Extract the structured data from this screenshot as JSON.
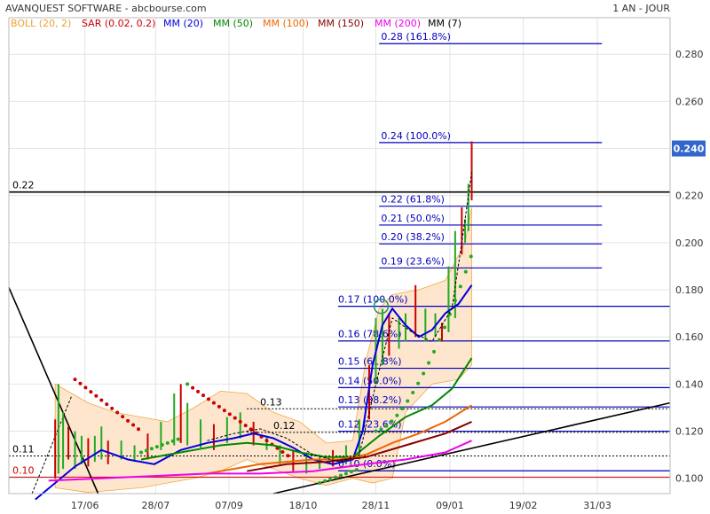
{
  "chart_data": {
    "type": "line",
    "title": "AVANQUEST SOFTWARE - abcbourse.com",
    "period": "1 AN - JOUR",
    "last_price": "0.240",
    "y_ticks": [
      "0.280",
      "0.260",
      "0.240",
      "0.220",
      "0.200",
      "0.180",
      "0.160",
      "0.140",
      "0.120",
      "0.100"
    ],
    "y_tick_values": [
      0.28,
      0.26,
      0.24,
      0.22,
      0.2,
      0.18,
      0.16,
      0.14,
      0.12,
      0.1
    ],
    "ylim": [
      0.0935,
      0.2955
    ],
    "x_ticks": [
      "17/06",
      "28/07",
      "07/09",
      "18/10",
      "28/11",
      "09/01",
      "19/02",
      "31/03"
    ],
    "grid": true,
    "legend": [
      {
        "label": "BOLL (20, 2)",
        "color": "#f0a030"
      },
      {
        "label": "SAR (0.02, 0.2)",
        "color": "#cc0000"
      },
      {
        "label": "MM (20)",
        "color": "#0000dd"
      },
      {
        "label": "MM (50)",
        "color": "#008800"
      },
      {
        "label": "MM (100)",
        "color": "#ee6600"
      },
      {
        "label": "MM (150)",
        "color": "#880000"
      },
      {
        "label": "MM (200)",
        "color": "#ee00ee"
      },
      {
        "label": "MM (7)",
        "color": "#000000"
      }
    ],
    "horizontal_levels": [
      {
        "label": "0.22",
        "value": 0.2215
      },
      {
        "label": "0.13",
        "value": 0.1295
      },
      {
        "label": "0.12",
        "value": 0.1195
      },
      {
        "label": "0.11",
        "value": 0.1095
      },
      {
        "label": "0.10",
        "value": 0.1005
      }
    ],
    "fibonacci_upper": [
      {
        "label": "0.28  (161.8%)",
        "value": 0.2845
      },
      {
        "label": "0.24  (100.0%)",
        "value": 0.2425
      },
      {
        "label": "0.22  (61.8%)",
        "value": 0.2155
      },
      {
        "label": "0.21  (50.0%)",
        "value": 0.2075
      },
      {
        "label": "0.20  (38.2%)",
        "value": 0.1995
      },
      {
        "label": "0.19  (23.6%)",
        "value": 0.1893
      }
    ],
    "fibonacci_lower": [
      {
        "label": "0.17  (100.0%)",
        "value": 0.173
      },
      {
        "label": "0.16  (78.6%)",
        "value": 0.1583
      },
      {
        "label": "0.15  (61.8%)",
        "value": 0.1467
      },
      {
        "label": "0.14  (50.0%)",
        "value": 0.1385
      },
      {
        "label": "0.13  (38.2%)",
        "value": 0.1303
      },
      {
        "label": "0.12  (23.6%)",
        "value": 0.12
      },
      {
        "label": "0.10  (0.0%)",
        "value": 0.1032
      }
    ],
    "series": [
      {
        "name": "MM (20)",
        "color": "#0000dd",
        "values": [
          [
            0.04,
            0.091
          ],
          [
            0.1,
            0.105
          ],
          [
            0.14,
            0.112
          ],
          [
            0.18,
            0.108
          ],
          [
            0.22,
            0.106
          ],
          [
            0.26,
            0.112
          ],
          [
            0.3,
            0.115
          ],
          [
            0.34,
            0.117
          ],
          [
            0.37,
            0.119
          ],
          [
            0.4,
            0.117
          ],
          [
            0.43,
            0.113
          ],
          [
            0.46,
            0.108
          ],
          [
            0.49,
            0.106
          ],
          [
            0.52,
            0.108
          ],
          [
            0.535,
            0.12
          ],
          [
            0.55,
            0.148
          ],
          [
            0.565,
            0.165
          ],
          [
            0.58,
            0.172
          ],
          [
            0.6,
            0.165
          ],
          [
            0.62,
            0.16
          ],
          [
            0.64,
            0.163
          ],
          [
            0.66,
            0.17
          ],
          [
            0.68,
            0.174
          ],
          [
            0.7,
            0.182
          ]
        ]
      },
      {
        "name": "MM (50)",
        "color": "#008800",
        "values": [
          [
            0.2,
            0.108
          ],
          [
            0.24,
            0.11
          ],
          [
            0.28,
            0.112
          ],
          [
            0.32,
            0.114
          ],
          [
            0.36,
            0.115
          ],
          [
            0.4,
            0.114
          ],
          [
            0.44,
            0.111
          ],
          [
            0.48,
            0.109
          ],
          [
            0.52,
            0.109
          ],
          [
            0.56,
            0.118
          ],
          [
            0.6,
            0.126
          ],
          [
            0.64,
            0.131
          ],
          [
            0.67,
            0.138
          ],
          [
            0.7,
            0.151
          ]
        ]
      },
      {
        "name": "MM (100)",
        "color": "#ee6600",
        "values": [
          [
            0.3,
            0.102
          ],
          [
            0.34,
            0.104
          ],
          [
            0.38,
            0.106
          ],
          [
            0.42,
            0.107
          ],
          [
            0.46,
            0.108
          ],
          [
            0.5,
            0.108
          ],
          [
            0.54,
            0.11
          ],
          [
            0.58,
            0.115
          ],
          [
            0.62,
            0.119
          ],
          [
            0.66,
            0.124
          ],
          [
            0.7,
            0.131
          ]
        ]
      },
      {
        "name": "MM (150)",
        "color": "#880000",
        "values": [
          [
            0.36,
            0.103
          ],
          [
            0.42,
            0.106
          ],
          [
            0.48,
            0.107
          ],
          [
            0.54,
            0.109
          ],
          [
            0.6,
            0.114
          ],
          [
            0.66,
            0.119
          ],
          [
            0.7,
            0.124
          ]
        ]
      },
      {
        "name": "MM (200)",
        "color": "#ee00ee",
        "values": [
          [
            0.06,
            0.099
          ],
          [
            0.14,
            0.1
          ],
          [
            0.22,
            0.101
          ],
          [
            0.3,
            0.102
          ],
          [
            0.38,
            0.102
          ],
          [
            0.46,
            0.103
          ],
          [
            0.54,
            0.106
          ],
          [
            0.6,
            0.108
          ],
          [
            0.66,
            0.111
          ],
          [
            0.7,
            0.116
          ]
        ]
      },
      {
        "name": "MM (7)",
        "color": "#000000",
        "values": [
          [
            0.3,
            0.116
          ],
          [
            0.34,
            0.119
          ],
          [
            0.38,
            0.121
          ],
          [
            0.42,
            0.117
          ],
          [
            0.46,
            0.11
          ],
          [
            0.5,
            0.107
          ],
          [
            0.53,
            0.11
          ],
          [
            0.555,
            0.14
          ],
          [
            0.58,
            0.168
          ],
          [
            0.61,
            0.162
          ],
          [
            0.64,
            0.158
          ],
          [
            0.67,
            0.172
          ],
          [
            0.685,
            0.2
          ],
          [
            0.7,
            0.23
          ]
        ]
      }
    ]
  }
}
